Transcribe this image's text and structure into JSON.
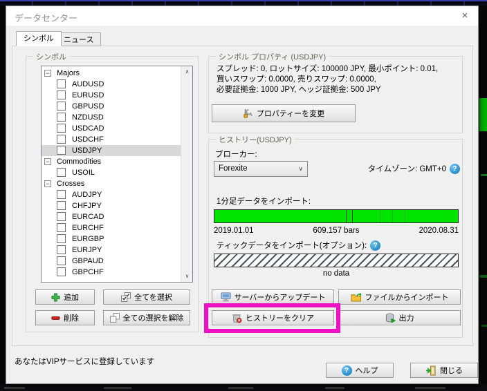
{
  "window": {
    "title": "データセンター",
    "close_glyph": "×"
  },
  "tabs": [
    {
      "label": "シンボル"
    },
    {
      "label": "ニュース"
    }
  ],
  "symbols_group": {
    "title": "シンボル",
    "tree": [
      {
        "label": "Majors",
        "group": true
      },
      {
        "label": "AUDUSD"
      },
      {
        "label": "EURUSD"
      },
      {
        "label": "GBPUSD"
      },
      {
        "label": "NZDUSD"
      },
      {
        "label": "USDCAD"
      },
      {
        "label": "USDCHF"
      },
      {
        "label": "USDJPY",
        "selected": true
      },
      {
        "label": "Commodities",
        "group": true
      },
      {
        "label": "USOIL"
      },
      {
        "label": "Crosses",
        "group": true
      },
      {
        "label": "AUDJPY"
      },
      {
        "label": "CHFJPY"
      },
      {
        "label": "EURCAD"
      },
      {
        "label": "EURCHF"
      },
      {
        "label": "EURGBP"
      },
      {
        "label": "EURJPY"
      },
      {
        "label": "GBPAUD"
      },
      {
        "label": "GBPCHF"
      }
    ],
    "buttons": {
      "add": "追加",
      "select_all": "全てを選択",
      "delete": "削除",
      "deselect_all": "全ての選択を解除"
    }
  },
  "properties_group": {
    "title": "シンボル プロパティ (USDJPY)",
    "line1": "スプレッド: 0, ロットサイズ: 100000 JPY, 最小ポイント: 0.01,",
    "line2": "買いスワップ: 0.0000, 売りスワップ: 0.0000,",
    "line3": "必要証拠金: 1000 JPY, ヘッジ証拠金: 500 JPY",
    "change_button": "プロパティーを変更"
  },
  "history_group": {
    "title": "ヒストリー(USDJPY)",
    "broker_label": "ブローカー:",
    "broker_value": "Forexite",
    "timezone_text": "タイムゾーン: GMT+0",
    "minute_label": "1分足データをインポート:",
    "minute_start": "2019.01.01",
    "minute_bars": "609.157 bars",
    "minute_end": "2020.08.31",
    "tick_label": "ティックデータをインポート(オプション):",
    "tick_status": "no data",
    "buttons": {
      "update_server": "サーバーからアップデート",
      "import_file": "ファイルからインポート",
      "clear_history": "ヒストリーをクリア",
      "export": "出力"
    }
  },
  "footer": {
    "status": "あなたはVIPサービスに登録しています",
    "help": "ヘルプ",
    "close": "閉じる"
  },
  "colors": {
    "highlight_magenta": "#ee10c4",
    "progress_green": "#00e400",
    "help_blue": "#2f95d0"
  }
}
